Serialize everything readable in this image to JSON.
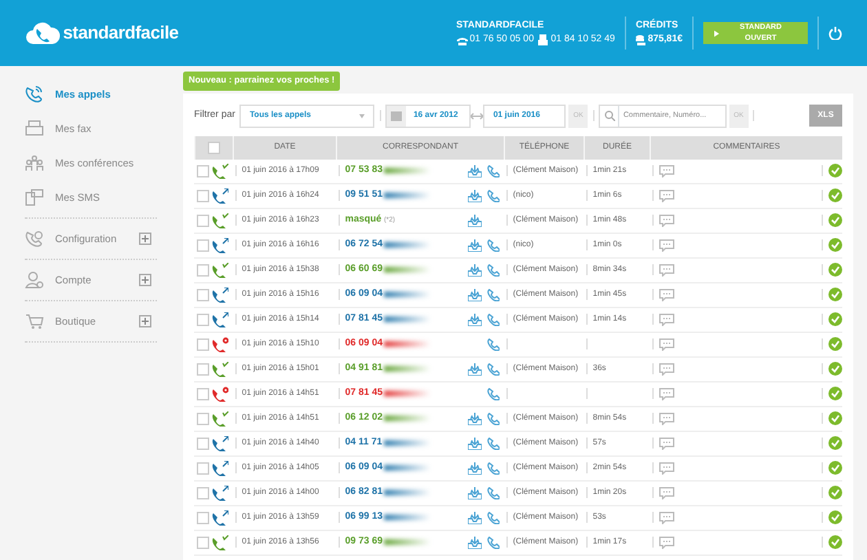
{
  "header": {
    "logo": "standardfacile",
    "account_title": "STANDARDFACILE",
    "phones": [
      {
        "kind": "landline",
        "number": "01 76 50 05 00"
      },
      {
        "kind": "fax",
        "number": "01 84 10 52 49"
      }
    ],
    "credits_title": "CRÉDITS",
    "credits": "875,81€",
    "status_button": "STANDARD OUVERT"
  },
  "banner": "Nouveau : parrainez vos proches !",
  "sidebar": [
    {
      "kind": "calls",
      "label": "Mes appels",
      "selected": true,
      "expandable": false
    },
    {
      "kind": "fax",
      "label": "Mes fax",
      "selected": false,
      "expandable": false
    },
    {
      "kind": "conf",
      "label": "Mes conférences",
      "selected": false,
      "expandable": false
    },
    {
      "kind": "sms",
      "label": "Mes SMS",
      "selected": false,
      "expandable": false
    },
    {
      "kind": "config",
      "label": "Configuration",
      "selected": false,
      "expandable": true
    },
    {
      "kind": "account",
      "label": "Compte",
      "selected": false,
      "expandable": true
    },
    {
      "kind": "shop",
      "label": "Boutique",
      "selected": false,
      "expandable": true
    }
  ],
  "filters": {
    "label": "Filtrer par",
    "type": "Tous les appels",
    "date_from": "16 avr 2012",
    "date_to": "01 juin 2016",
    "ok": "OK",
    "search_placeholder": "Commentaire, Numéro...",
    "search_ok": "OK",
    "export": "XLS"
  },
  "table": {
    "all_checked": false,
    "columns": [
      "DATE",
      "CORRESPONDANT",
      "TÉLÉPHONE",
      "DURÉE",
      "COMMENTAIRES"
    ],
    "rows": [
      {
        "kind": "incoming",
        "checked": false,
        "date": "01 juin 2016 à 17h09",
        "number": "07 53 83",
        "voicemail": true,
        "callback": true,
        "phone": "(Clément Maison)",
        "duration": "1min 21s"
      },
      {
        "kind": "outgoing",
        "checked": false,
        "date": "01 juin 2016 à 16h24",
        "number": "09 51 51",
        "voicemail": true,
        "callback": true,
        "phone": "(nico)",
        "duration": "1min 6s"
      },
      {
        "kind": "incoming",
        "checked": false,
        "date": "01 juin 2016 à 16h23",
        "number": "masqué",
        "note": "(*2)",
        "voicemail": true,
        "callback": false,
        "phone": "(Clément Maison)",
        "duration": "1min 48s"
      },
      {
        "kind": "outgoing",
        "checked": false,
        "date": "01 juin 2016 à 16h16",
        "number": "06 72 54",
        "voicemail": true,
        "callback": true,
        "phone": "(nico)",
        "duration": "1min 0s"
      },
      {
        "kind": "incoming",
        "checked": false,
        "date": "01 juin 2016 à 15h38",
        "number": "06 60 69",
        "voicemail": true,
        "callback": true,
        "phone": "(Clément Maison)",
        "duration": "8min 34s"
      },
      {
        "kind": "outgoing",
        "checked": false,
        "date": "01 juin 2016 à 15h16",
        "number": "06 09 04",
        "voicemail": true,
        "callback": true,
        "phone": "(Clément Maison)",
        "duration": "1min 45s"
      },
      {
        "kind": "outgoing",
        "checked": false,
        "date": "01 juin 2016 à 15h14",
        "number": "07 81 45",
        "voicemail": true,
        "callback": true,
        "phone": "(Clément Maison)",
        "duration": "1min 14s"
      },
      {
        "kind": "missed",
        "checked": false,
        "date": "01 juin 2016 à 15h10",
        "number": "06 09 04",
        "voicemail": false,
        "callback": true
      },
      {
        "kind": "incoming",
        "checked": false,
        "date": "01 juin 2016 à 15h01",
        "number": "04 91 81",
        "voicemail": true,
        "callback": true,
        "phone": "(Clément Maison)",
        "duration": "36s"
      },
      {
        "kind": "missed",
        "checked": false,
        "date": "01 juin 2016 à 14h51",
        "number": "07 81 45",
        "voicemail": false,
        "callback": true
      },
      {
        "kind": "incoming",
        "checked": false,
        "date": "01 juin 2016 à 14h51",
        "number": "06 12 02",
        "voicemail": true,
        "callback": true,
        "phone": "(Clément Maison)",
        "duration": "8min 54s"
      },
      {
        "kind": "outgoing",
        "checked": false,
        "date": "01 juin 2016 à 14h40",
        "number": "04 11 71",
        "voicemail": true,
        "callback": true,
        "phone": "(Clément Maison)",
        "duration": "57s"
      },
      {
        "kind": "outgoing",
        "checked": false,
        "date": "01 juin 2016 à 14h05",
        "number": "06 09 04",
        "voicemail": true,
        "callback": true,
        "phone": "(Clément Maison)",
        "duration": "2min 54s"
      },
      {
        "kind": "outgoing",
        "checked": false,
        "date": "01 juin 2016 à 14h00",
        "number": "06 82 81",
        "voicemail": true,
        "callback": true,
        "phone": "(Clément Maison)",
        "duration": "1min 20s"
      },
      {
        "kind": "outgoing",
        "checked": false,
        "date": "01 juin 2016 à 13h59",
        "number": "06 99 13",
        "voicemail": true,
        "callback": true,
        "phone": "(Clément Maison)",
        "duration": "53s"
      },
      {
        "kind": "incoming",
        "checked": false,
        "date": "01 juin 2016 à 13h56",
        "number": "09 73 69",
        "voicemail": true,
        "callback": true,
        "phone": "(Clément Maison)",
        "duration": "1min 17s"
      }
    ]
  }
}
